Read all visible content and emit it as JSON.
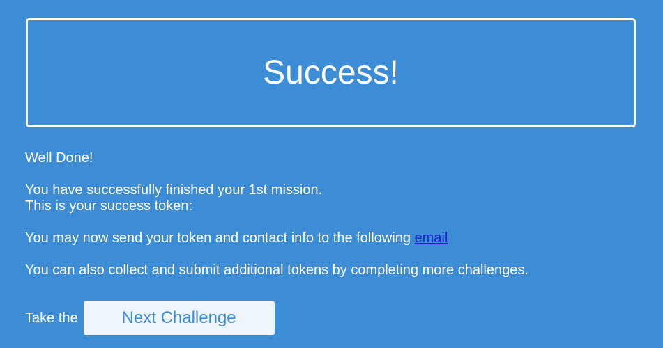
{
  "banner": {
    "title": "Success!"
  },
  "messages": {
    "well_done": "Well Done!",
    "mission_line": "You have successfully finished your 1st mission.",
    "token_line": "This is your success token:",
    "email_prefix": "You may now send your token and contact info to the following",
    "email_link": "email",
    "collect_line": "You can also collect and submit additional tokens by completing more challenges."
  },
  "next": {
    "prefix": "Take the",
    "button_label": "Next Challenge"
  },
  "colors": {
    "background": "#3d8dd6",
    "text": "#ffffff",
    "link": "#1f1fd6",
    "button_bg": "#eef5fc",
    "button_text": "#3d8dd6"
  }
}
